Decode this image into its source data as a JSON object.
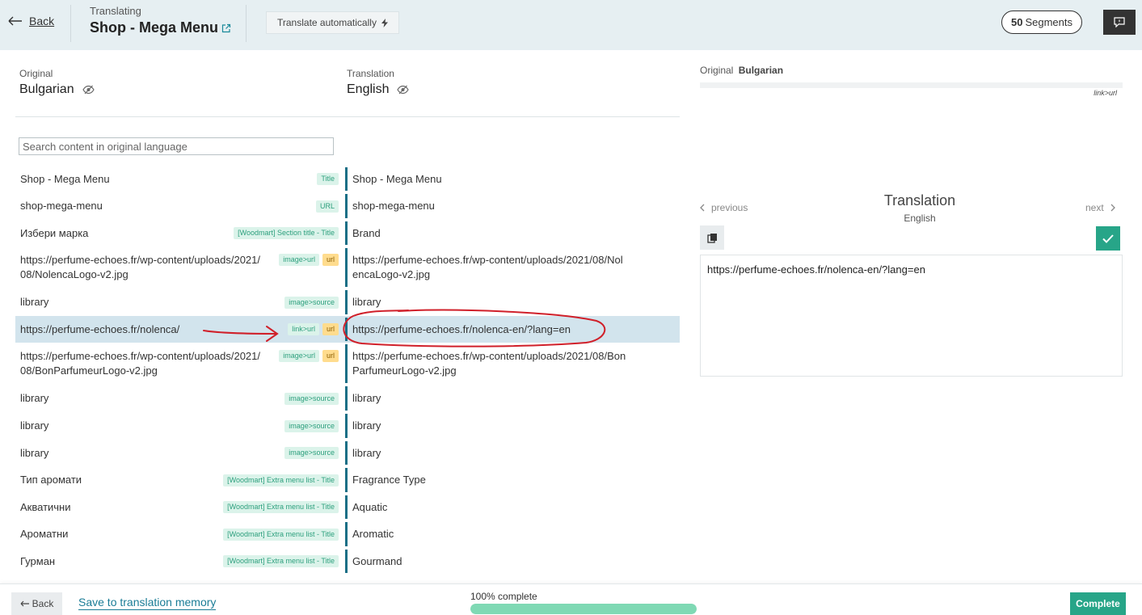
{
  "header": {
    "back_label": "Back",
    "subtitle": "Translating",
    "title": "Shop - Mega Menu",
    "translate_auto_label": "Translate automatically",
    "segments_count": "50",
    "segments_label": "Segments"
  },
  "original_lang": {
    "label": "Original",
    "name": "Bulgarian"
  },
  "translation_lang": {
    "label": "Translation",
    "name": "English"
  },
  "search": {
    "placeholder": "Search content in original language"
  },
  "rows": [
    {
      "orig": "Shop - Mega Menu",
      "tags": [
        "Title"
      ],
      "trans": "Shop - Mega Menu"
    },
    {
      "orig": "shop-mega-menu",
      "tags": [
        "URL"
      ],
      "trans": "shop-mega-menu"
    },
    {
      "orig": "Избери марка",
      "tags": [
        "[Woodmart] Section title - Title"
      ],
      "trans": "Brand"
    },
    {
      "orig": "https://perfume-echoes.fr/wp-content/uploads/2021/08/NolencaLogo-v2.jpg",
      "tags": [
        "image>url",
        "url"
      ],
      "trans": "https://perfume-echoes.fr/wp-content/uploads/2021/08/NolencaLogo-v2.jpg"
    },
    {
      "orig": "library",
      "tags": [
        "image>source"
      ],
      "trans": "library"
    },
    {
      "orig": "https://perfume-echoes.fr/nolenca/",
      "tags": [
        "link>url",
        "url"
      ],
      "trans": "https://perfume-echoes.fr/nolenca-en/?lang=en",
      "active": true
    },
    {
      "orig": "https://perfume-echoes.fr/wp-content/uploads/2021/08/BonParfumeurLogo-v2.jpg",
      "tags": [
        "image>url",
        "url"
      ],
      "trans": "https://perfume-echoes.fr/wp-content/uploads/2021/08/BonParfumeurLogo-v2.jpg"
    },
    {
      "orig": "library",
      "tags": [
        "image>source"
      ],
      "trans": "library"
    },
    {
      "orig": "library",
      "tags": [
        "image>source"
      ],
      "trans": "library"
    },
    {
      "orig": "library",
      "tags": [
        "image>source"
      ],
      "trans": "library"
    },
    {
      "orig": "Тип аромати",
      "tags": [
        "[Woodmart] Extra menu list - Title"
      ],
      "trans": "Fragrance Type"
    },
    {
      "orig": "Акватични",
      "tags": [
        "[Woodmart] Extra menu list - Title"
      ],
      "trans": "Aquatic"
    },
    {
      "orig": "Ароматни",
      "tags": [
        "[Woodmart] Extra menu list - Title"
      ],
      "trans": "Aromatic"
    },
    {
      "orig": "Гурман",
      "tags": [
        "[Woodmart] Extra menu list - Title"
      ],
      "trans": "Gourmand"
    }
  ],
  "right_panel": {
    "orig_label": "Original",
    "orig_lang": "Bulgarian",
    "segment_tag": "link>url",
    "prev_label": "previous",
    "next_label": "next",
    "title": "Translation",
    "lang": "English",
    "translation_value": "https://perfume-echoes.fr/nolenca-en/?lang=en"
  },
  "footer": {
    "back_label": "Back",
    "save_tm_label": "Save to translation memory",
    "progress_label": "100% complete",
    "progress_fraction": 1.0,
    "complete_label": "Complete"
  },
  "colors": {
    "accent": "#27a588",
    "progress": "#7fd9b4",
    "annotation": "#d0202a",
    "bar": "#1a6f86"
  }
}
